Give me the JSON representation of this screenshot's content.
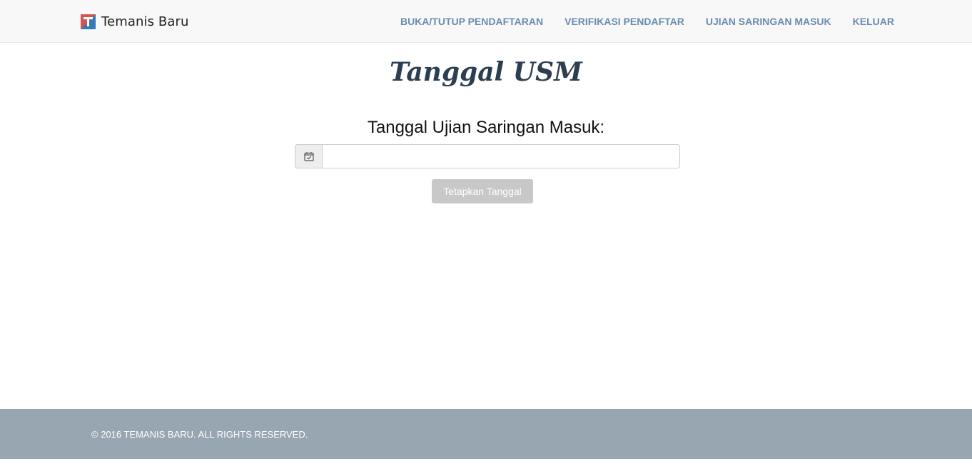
{
  "brand": {
    "name": "Temanis Baru"
  },
  "nav": {
    "items": [
      {
        "label": "BUKA/TUTUP PENDAFTARAN"
      },
      {
        "label": "VERIFIKASI PENDAFTAR"
      },
      {
        "label": "UJIAN SARINGAN MASUK"
      },
      {
        "label": "KELUAR"
      }
    ]
  },
  "main": {
    "title": "Tanggal USM",
    "form_label": "Tanggal Ujian Saringan Masuk:",
    "date_value": "",
    "submit_label": "Tetapkan Tanggal"
  },
  "footer": {
    "copyright": "© 2016 TEMANIS BARU. ALL RIGHTS RESERVED."
  },
  "colors": {
    "nav_link": "#6a8caf",
    "title": "#2c3e50",
    "footer_bg": "#98a6b2",
    "button_bg": "#c8c8c8",
    "logo_red": "#d9534f",
    "logo_blue": "#337ab7"
  },
  "icons": {
    "logo": "brand-logo-icon",
    "date_addon": "calendar-icon"
  }
}
